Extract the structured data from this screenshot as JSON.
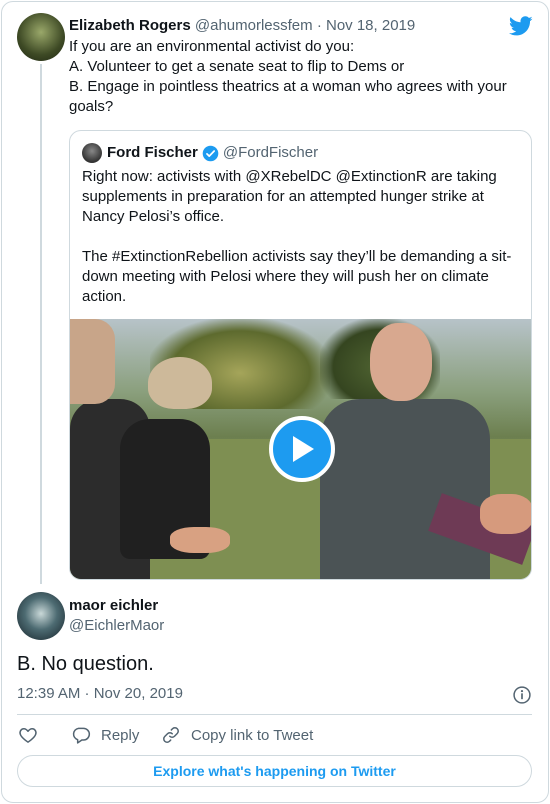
{
  "main_tweet": {
    "author_name": "Elizabeth Rogers",
    "handle": "@ahumorlessfem",
    "separator": "·",
    "date": "Nov 18, 2019",
    "lines": [
      "If you are an environmental activist do you:",
      "A. Volunteer to get a senate seat to flip to Dems or",
      "B. Engage in pointless theatrics at a woman who agrees with your",
      "goals?"
    ]
  },
  "quoted_tweet": {
    "author_name": "Ford Fischer",
    "handle": "@FordFischer",
    "paragraph1": [
      "Right now: activists with @XRebelDC @ExtinctionR are taking",
      "supplements in preparation for an attempted hunger strike at",
      "Nancy Pelosi’s office."
    ],
    "paragraph2": [
      "The #ExtinctionRebellion activists say they’ll be demanding a sit-",
      "down meeting with Pelosi where they will push her on climate",
      "action."
    ]
  },
  "reply_tweet": {
    "author_name": "maor eichler",
    "handle": "@EichlerMaor",
    "text": "B. No question.",
    "timestamp": "12:39 AM · Nov 20, 2019"
  },
  "actions": {
    "reply_label": "Reply",
    "copy_label": "Copy link to Tweet"
  },
  "explore_label": "Explore what's happening on Twitter",
  "colors": {
    "accent": "#1d9bf0",
    "text": "#0f1419",
    "muted": "#536471",
    "border": "#cfd9de"
  },
  "icons": [
    "twitter-bird-icon",
    "verified-badge-icon",
    "play-icon",
    "info-icon",
    "heart-icon",
    "reply-icon",
    "link-icon"
  ]
}
